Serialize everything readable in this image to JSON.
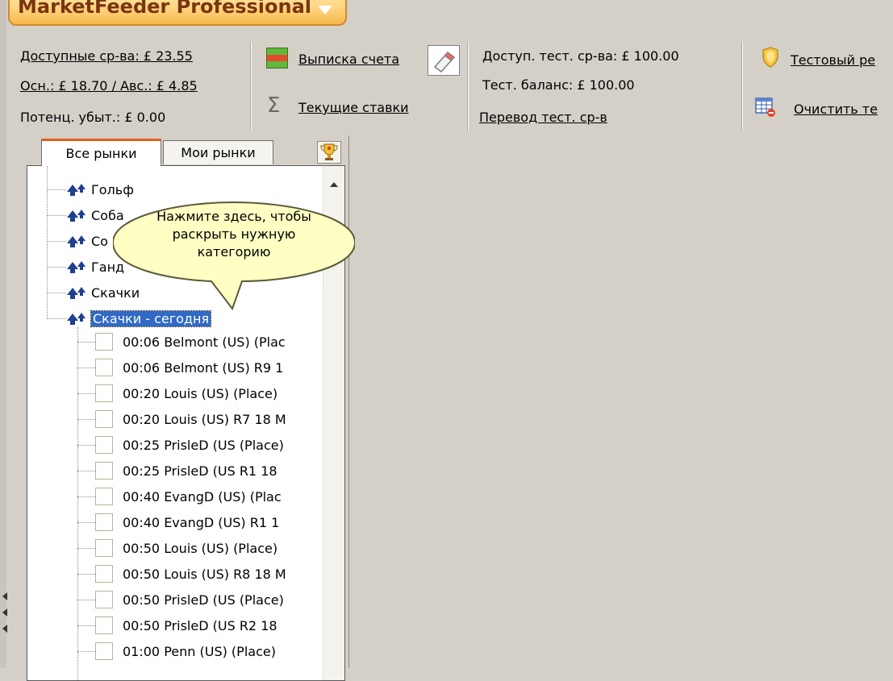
{
  "app": {
    "title": "MarketFeeder Professional"
  },
  "balances": {
    "available": "Доступные ср-ва: £ 23.55",
    "main_advance": "Осн.: £ 18.70 / Авс.: £ 4.85",
    "potential_loss": "Потенц. убыт.: £ 0.00"
  },
  "actions": {
    "statement": "Выписка счета",
    "current_bets": "Текущие ставки"
  },
  "test_balances": {
    "available": "Доступ. тест. ср-ва: £ 100.00",
    "balance": "Тест. баланс: £ 100.00",
    "transfer": "Перевод тест. ср-в"
  },
  "test_actions": {
    "test_mode": "Тестовый ре",
    "clear_test": "Очистить те"
  },
  "tabs": [
    {
      "label": "Все рынки",
      "active": true
    },
    {
      "label": "Мои рынки",
      "active": false
    }
  ],
  "categories": [
    "Гольф",
    "Соба",
    "Со",
    "Ганд",
    "Скачки",
    "Скачки - сегодня"
  ],
  "selected_category": "Скачки - сегодня",
  "callout": {
    "text": "Нажмите здесь, чтобы раскрыть нужную категорию"
  },
  "markets": [
    "00:06 Belmont (US)  (Plac",
    "00:06 Belmont (US)  R9 1",
    "00:20 Louis (US)  (Place)",
    "00:20 Louis (US)  R7 18 M",
    "00:25 PrisleD (US  (Place)",
    "00:25 PrisleD (US  R1 18",
    "00:40 EvangD (US)  (Plac",
    "00:40 EvangD (US)  R1 1",
    "00:50 Louis (US)  (Place)",
    "00:50 Louis (US)  R8 18 M",
    "00:50 PrisleD (US  (Place)",
    "00:50 PrisleD (US  R2 18",
    "01:00 Penn (US)  (Place)"
  ],
  "colors": {
    "background": "#d4d0c8",
    "selection": "#316ac5",
    "app_button": "#ffd27a",
    "active_tab_accent": "#e0601c",
    "callout_fill": "#ffffc4"
  },
  "icons": {
    "statement": "statement-icon",
    "eraser": "eraser-icon",
    "sigma": "sigma-icon",
    "shield": "shield-icon",
    "grid": "clear-grid-icon",
    "trophy": "trophy-icon",
    "category": "category-arrows-icon"
  }
}
